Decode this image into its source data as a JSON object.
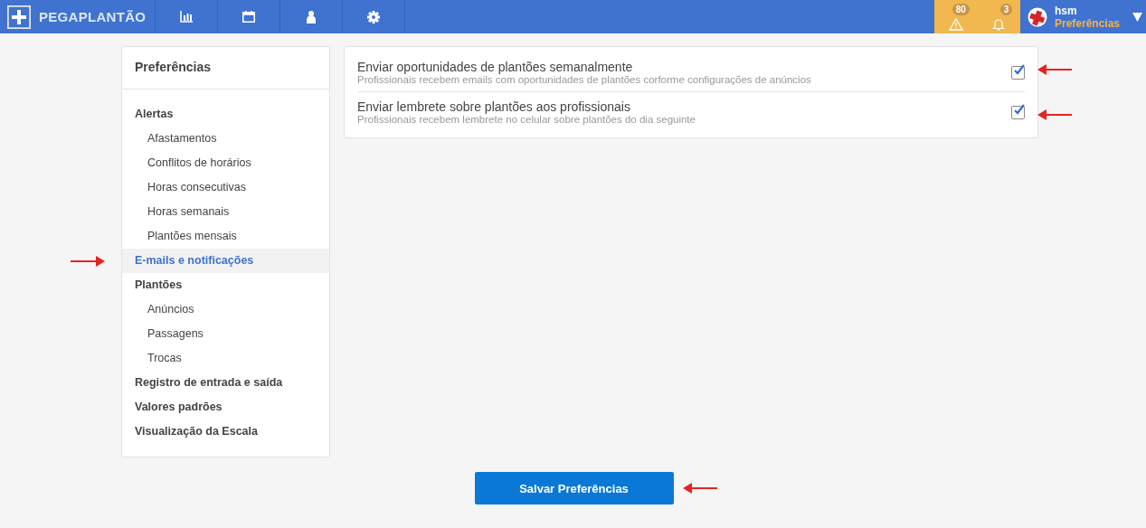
{
  "brand": {
    "prefix": "PEGA",
    "name": "PLANTÃO"
  },
  "nav": [
    {
      "kind": "chart",
      "selected": false
    },
    {
      "kind": "calendar",
      "selected": false
    },
    {
      "kind": "user",
      "selected": false
    },
    {
      "kind": "gear",
      "selected": false
    }
  ],
  "alerts": [
    {
      "kind": "warning",
      "count": "80"
    },
    {
      "kind": "bell",
      "count": "3"
    }
  ],
  "user": {
    "name": "hsm",
    "subtitle": "Preferências"
  },
  "sidebar": {
    "title": "Preferências",
    "items": [
      {
        "label": "Alertas",
        "selected": false,
        "children": [
          {
            "label": "Afastamentos",
            "selected": false
          },
          {
            "label": "Conflitos de horários",
            "selected": false
          },
          {
            "label": "Horas consecutivas",
            "selected": false
          },
          {
            "label": "Horas semanais",
            "selected": false
          },
          {
            "label": "Plantões mensais",
            "selected": false
          }
        ]
      },
      {
        "label": "E-mails e notificações",
        "selected": true,
        "annotated": true
      },
      {
        "label": "Plantões",
        "selected": false,
        "children": [
          {
            "label": "Anúncios",
            "selected": false
          },
          {
            "label": "Passagens",
            "selected": false
          },
          {
            "label": "Trocas",
            "selected": false
          }
        ]
      },
      {
        "label": "Registro de entrada e saída",
        "selected": false
      },
      {
        "label": "Valores padrões",
        "selected": false
      },
      {
        "label": "Visualização da Escala",
        "selected": false
      }
    ]
  },
  "settings": [
    {
      "title": "Enviar oportunidades de plantões semanalmente",
      "description": "Profissionais recebem emails com oportunidades de plantões corforme configurações de anúncios",
      "checked": true,
      "annotated": true
    },
    {
      "title": "Enviar lembrete sobre plantões aos profissionais",
      "description": "Profissionais recebem lembrete no celular sobre plantões do dia seguinte",
      "checked": true,
      "annotated": true
    }
  ],
  "save_button": {
    "label": "Salvar Preferências",
    "annotated": true
  }
}
